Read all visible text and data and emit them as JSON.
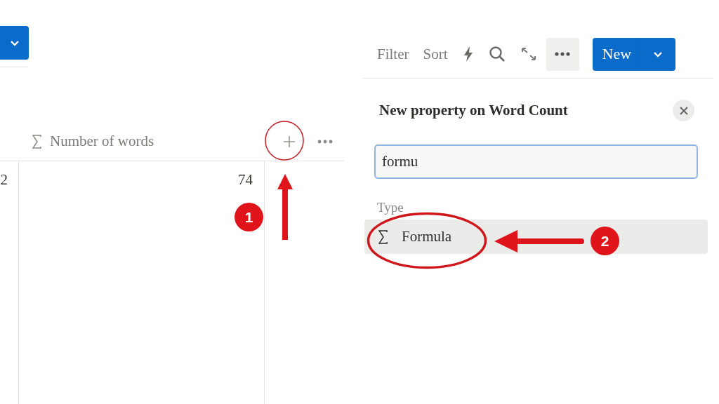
{
  "table": {
    "columns": [
      {
        "label": "Number of words"
      }
    ],
    "rows": [
      {
        "cells": [
          "2",
          "74"
        ]
      }
    ]
  },
  "toolbar": {
    "items": [
      {
        "label": "Filter"
      },
      {
        "label": "Sort"
      }
    ],
    "new_button": {
      "label": "New"
    }
  },
  "popup": {
    "title": "New property on Word Count",
    "search": {
      "value": "formu"
    },
    "section_label": "Type",
    "options": [
      {
        "label": "Formula",
        "selected": true
      }
    ]
  },
  "annotations": [
    {
      "label": "1"
    },
    {
      "label": "2"
    }
  ]
}
